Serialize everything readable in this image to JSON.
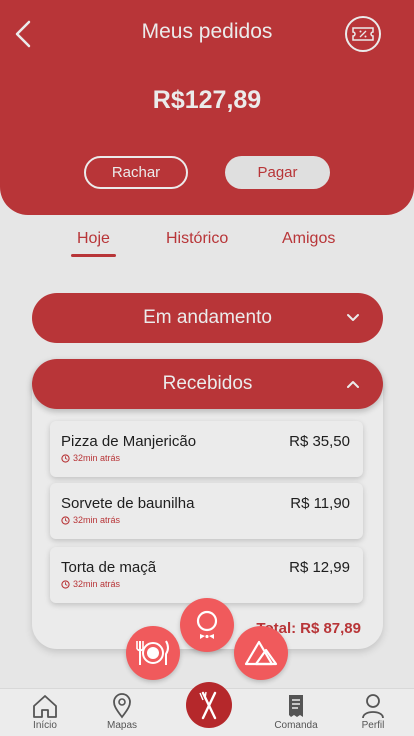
{
  "header": {
    "title": "Meus pedidos",
    "amount": "R$127,89",
    "split_label": "Rachar",
    "pay_label": "Pagar"
  },
  "tabs": [
    {
      "label": "Hoje",
      "active": true
    },
    {
      "label": "Histórico",
      "active": false
    },
    {
      "label": "Amigos",
      "active": false
    }
  ],
  "sections": {
    "in_progress": {
      "label": "Em andamento"
    },
    "received": {
      "label": "Recebidos"
    }
  },
  "orders": [
    {
      "name": "Pizza de Manjericão",
      "price": "R$ 35,50",
      "time": "32min atrás"
    },
    {
      "name": "Sorvete de baunilha",
      "price": "R$ 11,90",
      "time": "32min atrás"
    },
    {
      "name": "Torta de maçã",
      "price": "R$ 12,99",
      "time": "32min atrás"
    }
  ],
  "total": {
    "label": "Total:",
    "value": "R$ 87,89"
  },
  "fabs": [
    "dinner-plate-icon",
    "waiter-icon",
    "alert-triangle-icon"
  ],
  "bottom_nav": [
    {
      "label": "Início",
      "icon": "home-icon"
    },
    {
      "label": "Mapas",
      "icon": "map-pin-icon"
    },
    {
      "label": "Comanda",
      "icon": "receipt-icon"
    },
    {
      "label": "Perfil",
      "icon": "user-icon"
    }
  ],
  "colors": {
    "primary": "#c83a3d",
    "fab": "#f05a5c",
    "dark": "#b5282b"
  }
}
